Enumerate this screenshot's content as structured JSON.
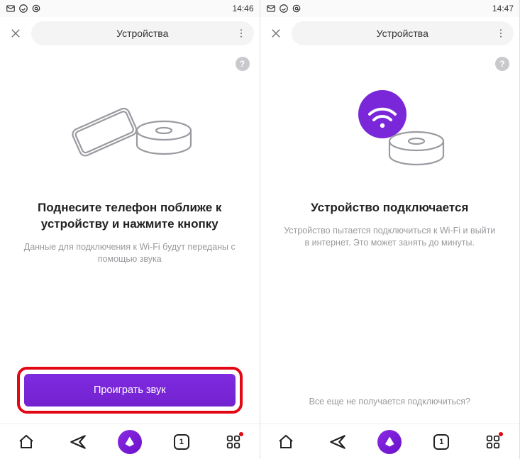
{
  "left": {
    "status_time": "14:46",
    "top_title": "Устройства",
    "help_label": "?",
    "heading": "Поднесите телефон поближе к устройству и нажмите кнопку",
    "subtext": "Данные для подключения к Wi-Fi будут переданы с помощью звука",
    "button_label": "Проиграть звук",
    "nav_count": "1"
  },
  "right": {
    "status_time": "14:47",
    "top_title": "Устройства",
    "help_label": "?",
    "heading": "Устройство подключается",
    "subtext": "Устройство пытается подключиться к Wi-Fi и выйти в интернет. Это может занять до минуты.",
    "link_label": "Все еще не получается подключиться?",
    "nav_count": "1"
  }
}
